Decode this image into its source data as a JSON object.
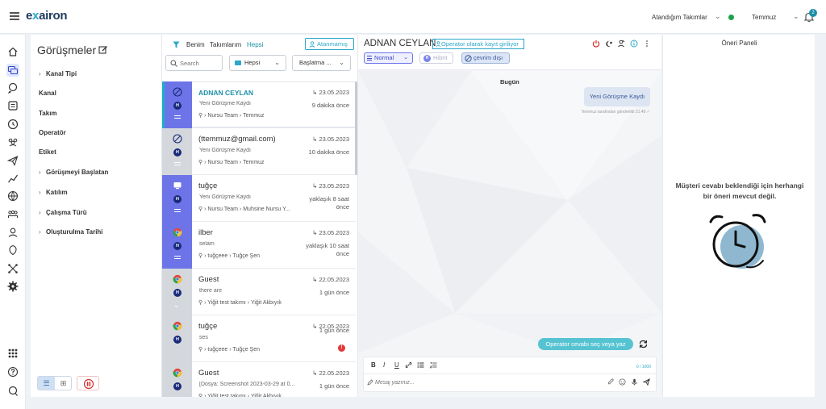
{
  "brand": {
    "logo_text_a": "e",
    "logo_text_x": "x",
    "logo_text_b": "airon"
  },
  "topbar": {
    "team_selector": "Atandığım Takımlar",
    "user": "Temmuz",
    "notif_count": "2"
  },
  "filters": {
    "title": "Görüşmeler",
    "items": [
      {
        "label": "Kanal Tipi",
        "expandable": true
      },
      {
        "label": "Kanal",
        "expandable": false
      },
      {
        "label": "Takım",
        "expandable": false
      },
      {
        "label": "Operatör",
        "expandable": false
      },
      {
        "label": "Etiket",
        "expandable": false
      },
      {
        "label": "Görüşmeyi Başlatan",
        "expandable": true
      },
      {
        "label": "Katılım",
        "expandable": true
      },
      {
        "label": "Çalışma Türü",
        "expandable": true
      },
      {
        "label": "Oluşturulma Tarihi",
        "expandable": true
      }
    ]
  },
  "list": {
    "tabs": {
      "mine": "Benim",
      "teams": "Takımlarım",
      "all": "Hepsi"
    },
    "assign_button": "Atanmamış",
    "search_placeholder": "Search",
    "channel_filter": "Hepsi",
    "sort_filter": "Başlatma ...",
    "conversations": [
      {
        "name": "ADNAN CEYLAN",
        "date": "23.05.2023",
        "message": "Yeni Görüşme Kaydı",
        "ago": "9 dakika önce",
        "team": "Nursu Team",
        "operator": "Temmuz",
        "channel": "webchat",
        "selected": true
      },
      {
        "name": "(ttemmuz@gmail.com)",
        "date": "23.05.2023",
        "message": "Yeni Görüşme Kaydı",
        "ago": "10 dakika önce",
        "team": "Nursu Team",
        "operator": "Temmuz",
        "channel": "webchat",
        "selected": false
      },
      {
        "name": "tuğçe",
        "date": "23.05.2023",
        "message": "Yeni Görüşme Kaydı",
        "ago": "yaklaşık 8 saat önce",
        "team": "Nursu Team",
        "operator": "Muhsine Nursu Y...",
        "channel": "desktop",
        "selected": false
      },
      {
        "name": "ilber",
        "date": "23.05.2023",
        "message": "selam",
        "ago": "yaklaşık 10 saat önce",
        "team": "tuğçeee",
        "operator": "Tuğçe Şen",
        "channel": "chrome",
        "selected": false
      },
      {
        "name": "Guest",
        "date": "22.05.2023",
        "message": "there are",
        "ago": "1 gün önce",
        "team": "Yiğit test takımı",
        "operator": "Yiğit Akbıyık",
        "channel": "chrome",
        "selected": false
      },
      {
        "name": "tuğçe",
        "date": "22.05.2023",
        "message": "ses",
        "ago": "1 gün önce",
        "team": "tuğçeee",
        "operator": "Tuğçe Şen",
        "channel": "chrome",
        "selected": false,
        "alert": "!"
      },
      {
        "name": "Guest",
        "date": "22.05.2023",
        "message": "[Dosya: Screenshot 2023-03-29 at 0...",
        "ago": "1 gün önce",
        "team": "Yiğit test takımı",
        "operator": "Yiğit Akbıyık",
        "channel": "chrome",
        "selected": false
      }
    ]
  },
  "chat": {
    "customer_name": "ADNAN CEYLAN",
    "operator_badge": "Operator olarak kayıt giriliyor",
    "mode_select": "Normal",
    "hibrit_label": "Hibrit",
    "hibrit_badge": "H",
    "status_label": "çevrim dışı",
    "day_label": "Bugün",
    "messages": [
      {
        "text": "Yeni Görüşme Kaydı",
        "meta": "Temmuz tarafından gönderildi 21:49 ✓"
      }
    ],
    "suggest_button": "Operator cevabı seç veya yaz",
    "composer": {
      "placeholder": "Mesaj yazınız...",
      "counter": "0 / 1000",
      "bold": "B",
      "italic": "I",
      "underline": "U"
    }
  },
  "suggest_panel": {
    "title": "Öneri Paneli",
    "empty_message": "Müşteri cevabı beklendiği için herhangi bir öneri mevcut değil."
  },
  "colors": {
    "accent": "#2aa7c9",
    "purple": "#6d74e8",
    "navy": "#1a2a7a",
    "online": "#1aa34a"
  }
}
